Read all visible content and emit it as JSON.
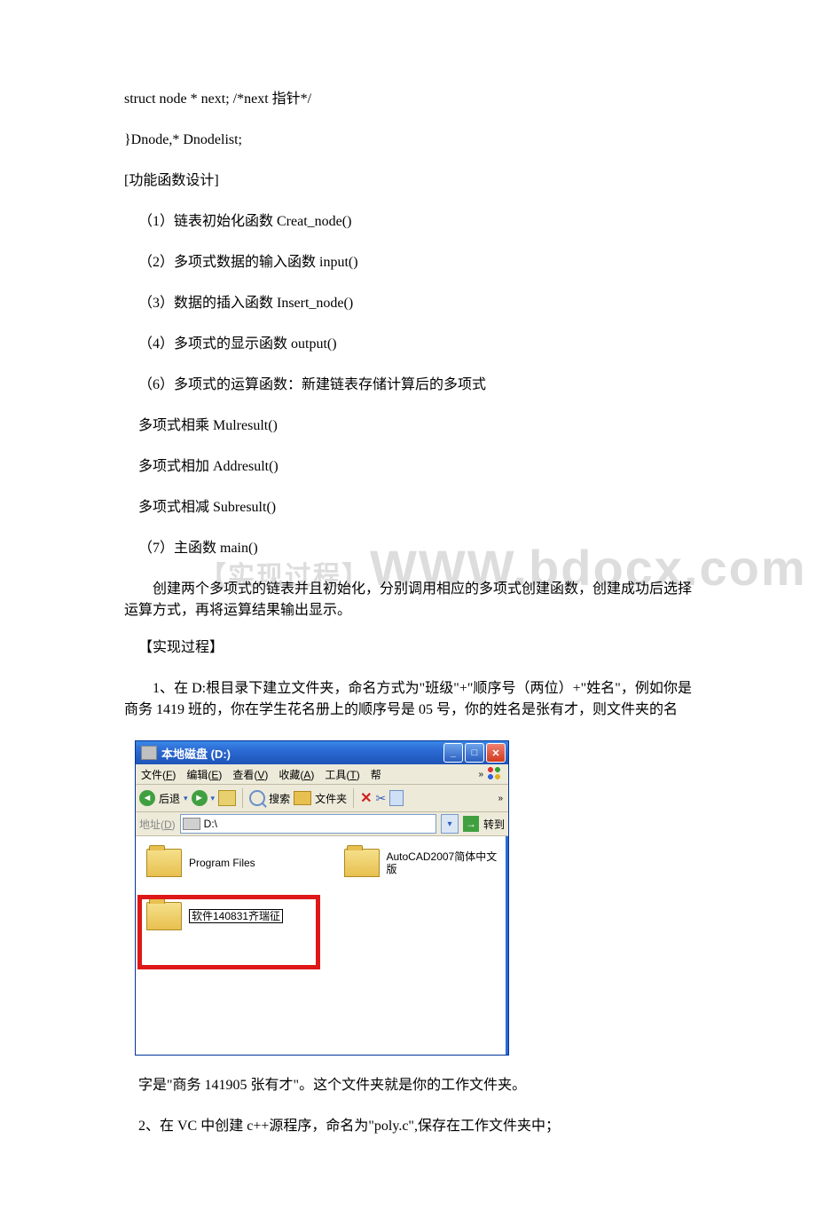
{
  "lines": {
    "l1": " struct node * next; /*next 指针*/",
    "l2": "}Dnode,* Dnodelist;",
    "l3": "[功能函数设计]",
    "l4": "（1）链表初始化函数 Creat_node()",
    "l5": "（2）多项式数据的输入函数 input()",
    "l6": "（3）数据的插入函数 Insert_node()",
    "l7": "（4）多项式的显示函数 output()",
    "l8": "（6）多项式的运算函数：新建链表存储计算后的多项式",
    "l9": "多项式相乘 Mulresult()",
    "l10": "多项式相加 Addresult()",
    "l11": "多项式相减 Subresult()",
    "l12": "（7）主函数 main()",
    "l13": "创建两个多项式的链表并且初始化，分别调用相应的多项式创建函数，创建成功后选择运算方式，再将运算结果输出显示。",
    "l14": "【实现过程】",
    "l15": "1、在 D:根目录下建立文件夹，命名方式为\"班级\"+\"顺序号（两位）+\"姓名\"，例如你是商务 1419 班的，你在学生花名册上的顺序号是 05 号，你的姓名是张有才，则文件夹的名",
    "l16": "字是\"商务 141905 张有才\"。这个文件夹就是你的工作文件夹。",
    "l17": "2、在 VC 中创建 c++源程序，命名为\"poly.c\",保存在工作文件夹中；"
  },
  "watermark": "WWW.bdocx.com",
  "xp": {
    "title": "本地磁盘 (D:)",
    "menu": {
      "file": "文件(F)",
      "edit": "编辑(E)",
      "view": "查看(V)",
      "fav": "收藏(A)",
      "tools": "工具(T)",
      "help": "帮",
      "chev": "»"
    },
    "toolbar": {
      "back": "后退",
      "dd": "▾",
      "search": "搜索",
      "folder": "文件夹",
      "chev": "»"
    },
    "addr": {
      "label": "地址(D)",
      "path": "D:\\",
      "go": "转到"
    },
    "files": {
      "pf": "Program Files",
      "cad": "AutoCAD2007简体中文版",
      "new": "软件140831齐瑞征"
    }
  }
}
